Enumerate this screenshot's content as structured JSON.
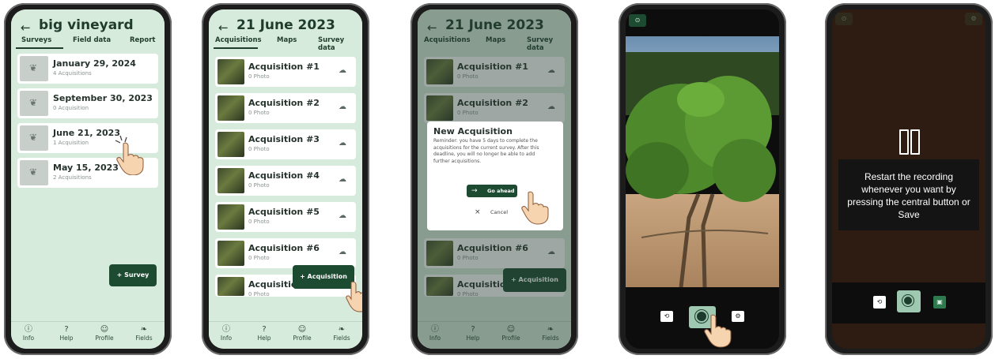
{
  "screen1": {
    "back": "←",
    "title": "big vineyard",
    "tabs": [
      "Surveys",
      "Field data",
      "Report"
    ],
    "surveys": [
      {
        "date": "January 29, 2024",
        "count": "4 Acquisitions"
      },
      {
        "date": "September 30, 2023",
        "count": "0 Acquisition"
      },
      {
        "date": "June 21, 2023",
        "count": "1 Acquisition"
      },
      {
        "date": "May 15, 2023",
        "count": "2 Acquisitions"
      }
    ],
    "fab": "+  Survey"
  },
  "screen2": {
    "back": "←",
    "title": "21 June 2023",
    "tabs": [
      "Acquisitions",
      "Maps",
      "Survey data"
    ],
    "acquisitions": [
      {
        "name": "Acquisition #1",
        "photo": "0 Photo"
      },
      {
        "name": "Acquisition #2",
        "photo": "0 Photo"
      },
      {
        "name": "Acquisition #3",
        "photo": "0 Photo"
      },
      {
        "name": "Acquisition #4",
        "photo": "0 Photo"
      },
      {
        "name": "Acquisition #5",
        "photo": "0 Photo"
      },
      {
        "name": "Acquisition #6",
        "photo": "0 Photo"
      },
      {
        "name": "Acquisition",
        "photo": "0 Photo"
      }
    ],
    "fab": "+  Acquisition"
  },
  "screen3": {
    "dialog_title": "New Acquisition",
    "dialog_body": "Reminder: you have 5 days to complete the acquisitions for the current survey. After this deadline, you will no longer be able to add further acquisitions.",
    "go_ahead": "Go ahead",
    "cancel": "Cancel",
    "fab": "+  Acquisition"
  },
  "screen5": {
    "message": "Restart the recording whenever you want by pressing the central button or Save"
  },
  "nav": [
    {
      "label": "Info",
      "icon": "info-icon"
    },
    {
      "label": "Help",
      "icon": "help-icon"
    },
    {
      "label": "Profile",
      "icon": "profile-icon"
    },
    {
      "label": "Fields",
      "icon": "fields-icon"
    }
  ],
  "colors": {
    "accent": "#1d4b32",
    "mint": "#d7ebdd",
    "card": "#ffffff"
  }
}
